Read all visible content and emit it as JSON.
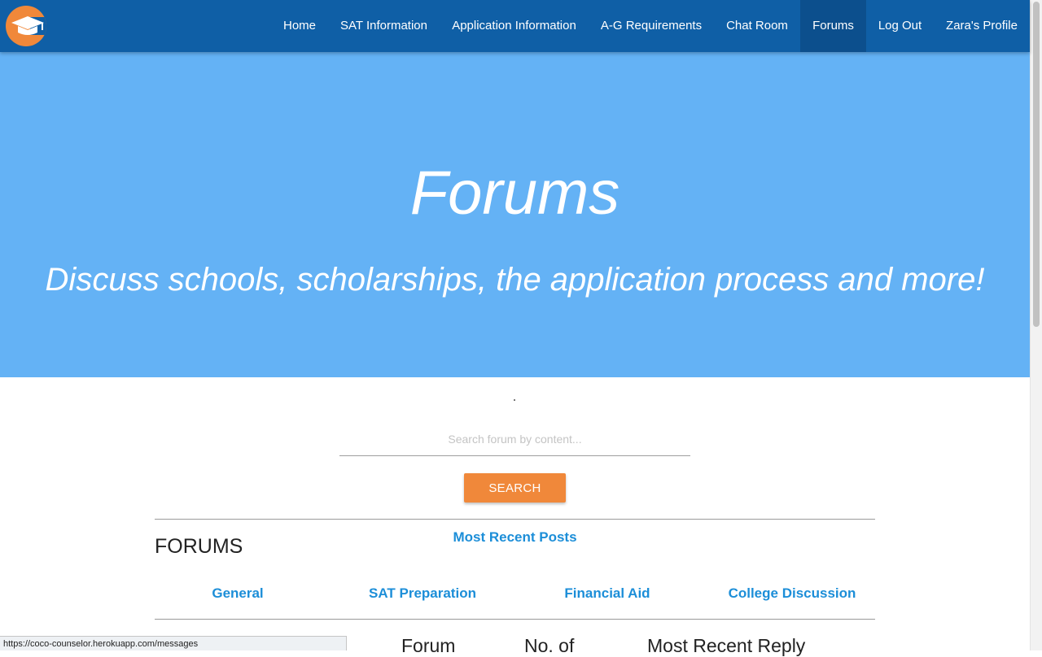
{
  "brand": {
    "logo_icon": "graduation-cap-icon",
    "color": "#f0883a"
  },
  "colors": {
    "navbar": "#0f5fa6",
    "hero": "#64b2f5",
    "accent": "#f0883a",
    "link": "#1c8ed8"
  },
  "nav": {
    "items": [
      {
        "label": "Home"
      },
      {
        "label": "SAT Information"
      },
      {
        "label": "Application Information"
      },
      {
        "label": "A-G Requirements"
      },
      {
        "label": "Chat Room"
      },
      {
        "label": "Forums",
        "active": true
      },
      {
        "label": "Log Out"
      },
      {
        "label": "Zara's Profile"
      }
    ]
  },
  "hero": {
    "title": "Forums",
    "subtitle": "Discuss schools, scholarships, the application process and more!"
  },
  "search": {
    "placeholder": "Search forum by content...",
    "value": "",
    "button_label": "SEARCH"
  },
  "forums": {
    "heading": "FORUMS",
    "recent_link": "Most Recent Posts",
    "categories": [
      "General",
      "SAT Preparation",
      "Financial Aid",
      "College Discussion"
    ],
    "table_headers": [
      "Forum",
      "No. of",
      "Most Recent Reply"
    ]
  },
  "status_bar": {
    "url": "https://coco-counselor.herokuapp.com/messages"
  }
}
